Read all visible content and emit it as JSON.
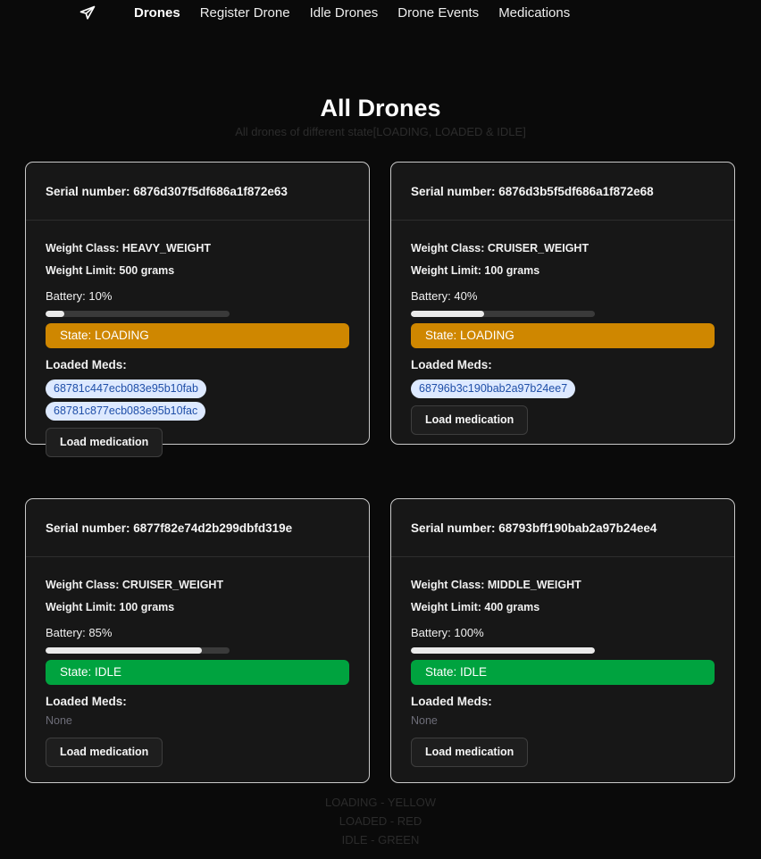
{
  "nav": {
    "logo_icon": "airplane-icon",
    "links": [
      "Drones",
      "Register Drone",
      "Idle Drones",
      "Drone Events",
      "Medications"
    ],
    "active": "Drones"
  },
  "page": {
    "title": "All Drones",
    "subtitle": "All drones of different state[LOADING, LOADED & IDLE]"
  },
  "drones": [
    {
      "serial": "Serial number: 6876d307f5df686a1f872e63",
      "weight_class": "Weight Class: HEAVY_WEIGHT",
      "weight_limit": "Weight Limit: 500 grams",
      "battery": "Battery: 10%",
      "battery_level": 10,
      "state": "State: LOADING",
      "state_color": "#cf8700",
      "meds_label": "Loaded Meds:",
      "meds": [
        "68781c447ecb083e95b10fab",
        "68781c877ecb083e95b10fac"
      ],
      "button": "Load medication"
    },
    {
      "serial": "Serial number: 6876d3b5f5df686a1f872e68",
      "weight_class": "Weight Class: CRUISER_WEIGHT",
      "weight_limit": "Weight Limit: 100 grams",
      "battery": "Battery: 40%",
      "battery_level": 40,
      "state": "State: LOADING",
      "state_color": "#cf8700",
      "meds_label": "Loaded Meds:",
      "meds": [
        "68796b3c190bab2a97b24ee7"
      ],
      "button": "Load medication"
    },
    {
      "serial": "Serial number: 6877f82e74d2b299dbfd319e",
      "weight_class": "Weight Class: CRUISER_WEIGHT",
      "weight_limit": "Weight Limit: 100 grams",
      "battery": "Battery: 85%",
      "battery_level": 85,
      "state": "State: IDLE",
      "state_color": "#00a33f",
      "meds_label": "Loaded Meds:",
      "meds": [],
      "none_text": "None",
      "button": "Load medication"
    },
    {
      "serial": "Serial number: 68793bff190bab2a97b24ee4",
      "weight_class": "Weight Class: MIDDLE_WEIGHT",
      "weight_limit": "Weight Limit: 400 grams",
      "battery": "Battery: 100%",
      "battery_level": 100,
      "state": "State: IDLE",
      "state_color": "#00a33f",
      "meds_label": "Loaded Meds:",
      "meds": [],
      "none_text": "None",
      "button": "Load medication"
    }
  ],
  "legend": [
    "LOADING - YELLOW",
    "LOADED - RED",
    "IDLE - GREEN"
  ]
}
